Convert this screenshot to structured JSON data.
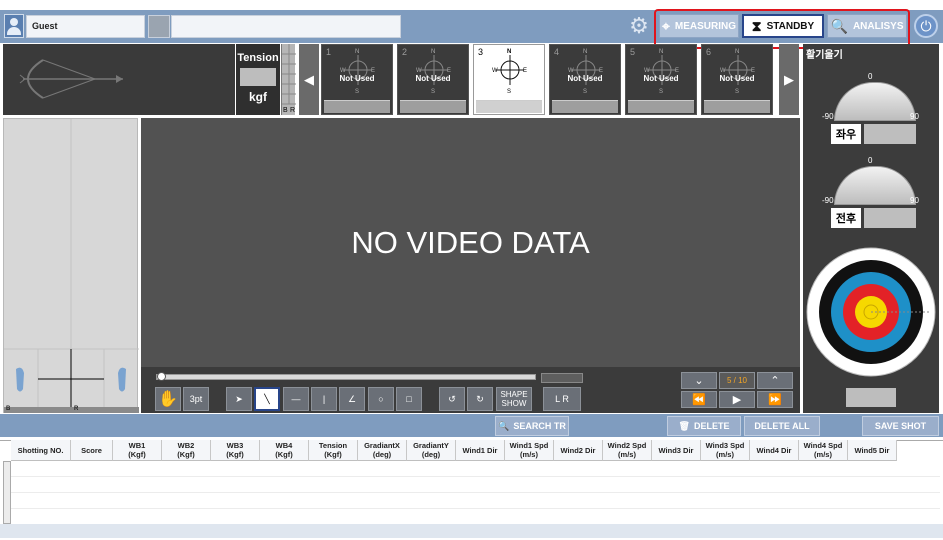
{
  "header": {
    "user_name": "Guest",
    "modes": [
      {
        "label": "MEASURING",
        "icon": "crosshair-icon"
      },
      {
        "label": "STANDBY",
        "icon": "hourglass-icon",
        "selected": true
      },
      {
        "label": "ANALISYS",
        "icon": "magnify-chart-icon"
      }
    ]
  },
  "tension": {
    "label": "Tension",
    "unit": "kgf"
  },
  "cameras": [
    {
      "num": "1",
      "status": "Not Used"
    },
    {
      "num": "2",
      "status": "Not Used"
    },
    {
      "num": "3",
      "status": "",
      "active": true
    },
    {
      "num": "4",
      "status": "Not Used"
    },
    {
      "num": "5",
      "status": "Not Used"
    },
    {
      "num": "6",
      "status": "Not Used"
    }
  ],
  "compass": {
    "n": "N",
    "s": "S",
    "e": "E",
    "w": "W"
  },
  "strip_labels": {
    "b": "B",
    "r": "R"
  },
  "video": {
    "message": "NO VIDEO DATA"
  },
  "tools": {
    "pt_label": "3pt",
    "shape_show": "SHAPE SHOW",
    "lr": "L  R"
  },
  "playback": {
    "page": "5 / 10"
  },
  "gauges": {
    "title": "활기울기",
    "g1": {
      "label": "좌우",
      "min": "-90",
      "zero": "0",
      "max": "90"
    },
    "g2": {
      "label": "전후",
      "min": "-90",
      "zero": "0",
      "max": "90"
    }
  },
  "actions": {
    "search": "SEARCH TR",
    "delete": "DELETE",
    "delete_all": "DELETE ALL",
    "save_shot": "SAVE SHOT"
  },
  "table": {
    "columns": [
      "Shotting NO.",
      "Score",
      "WB1\n(Kgf)",
      "WB2\n(Kgf)",
      "WB3\n(Kgf)",
      "WB4\n(Kgf)",
      "Tension\n(Kgf)",
      "GradiantX\n(deg)",
      "GradiantY\n(deg)",
      "Wind1 Dir",
      "Wind1 Spd\n(m/s)",
      "Wind2 Dir",
      "Wind2 Spd\n(m/s)",
      "Wind3 Dir",
      "Wind3 Spd\n(m/s)",
      "Wind4 Dir",
      "Wind4 Spd\n(m/s)",
      "Wind5 Dir"
    ]
  },
  "colors": {
    "accent": "#7f9cbf",
    "highlight": "#e0141c",
    "selected_border": "#28458a"
  }
}
